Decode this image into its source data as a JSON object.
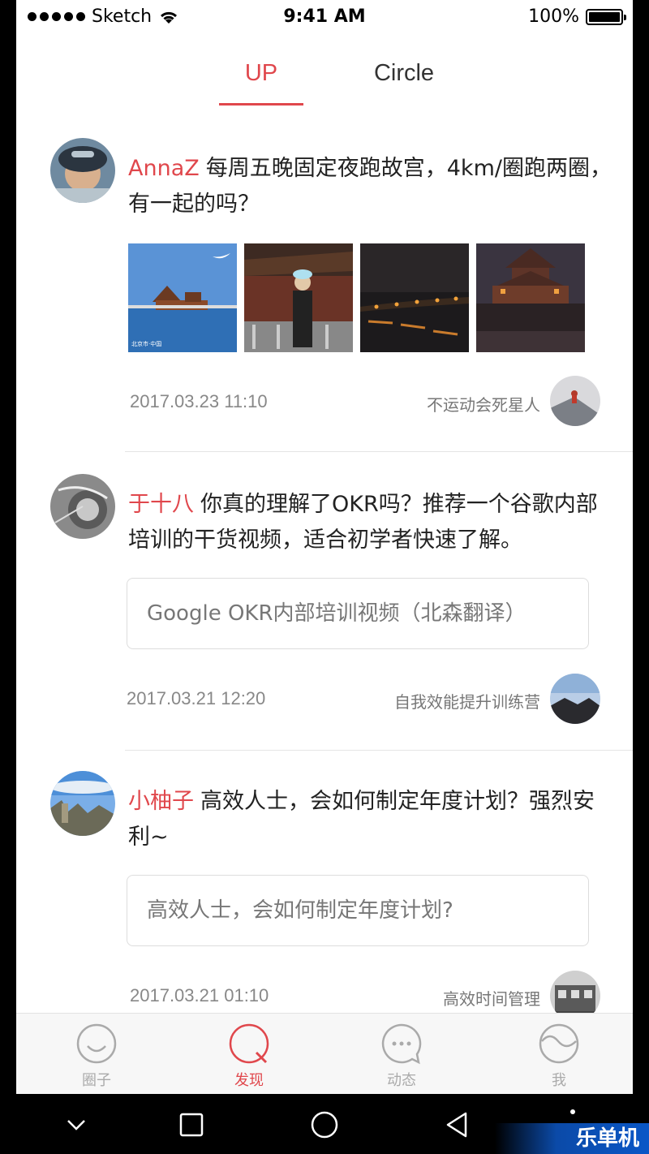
{
  "status_bar": {
    "carrier": "Sketch",
    "time": "9:41 AM",
    "battery": "100%"
  },
  "tabs": [
    {
      "label": "UP",
      "active": true
    },
    {
      "label": "Circle",
      "active": false
    }
  ],
  "accent_color": "#e0474c",
  "posts": [
    {
      "author": "AnnaZ",
      "text": "每周五晚固定夜跑故宫，4km/圈跑两圈，有一起的吗？",
      "date": "2017.03.23 11:10",
      "circle": "不运动会死星人",
      "photo_caption": "北京市·中国"
    },
    {
      "author": "于十八",
      "text": "你真的理解了OKR吗？推荐一个谷歌内部培训的干货视频，适合初学者快速了解。",
      "link": "Google OKR内部培训视频（北森翻译）",
      "date": "2017.03.21 12:20",
      "circle": "自我效能提升训练营"
    },
    {
      "author": "小柚子",
      "text": "高效人士，会如何制定年度计划？强烈安利~",
      "link": "高效人士，会如何制定年度计划?",
      "date": "2017.03.21 01:10",
      "circle": "高效时间管理"
    }
  ],
  "tab_bar": [
    {
      "label": "圈子",
      "icon": "smile-icon"
    },
    {
      "label": "发现",
      "icon": "discover-icon",
      "active": true
    },
    {
      "label": "动态",
      "icon": "chat-bubble-icon"
    },
    {
      "label": "我",
      "icon": "profile-icon"
    }
  ],
  "watermark": "乐单机"
}
